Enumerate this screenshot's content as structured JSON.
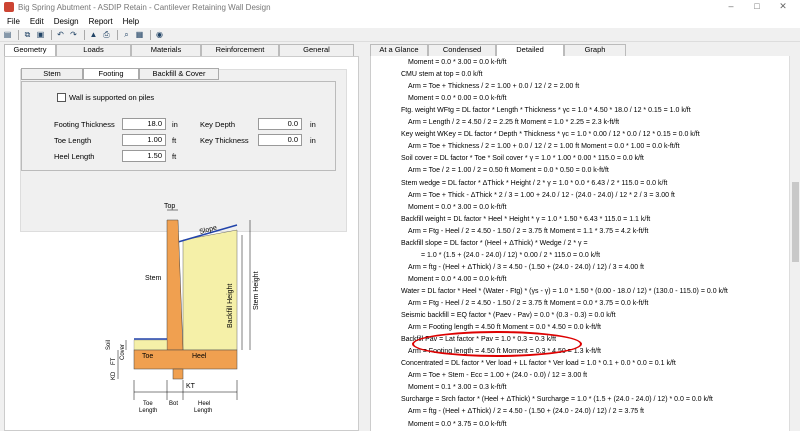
{
  "window": {
    "title": "Big Spring Abutment - ASDIP Retain - Cantilever Retaining Wall Design",
    "controls": [
      "–",
      "□",
      "✕"
    ]
  },
  "menu": [
    "File",
    "Edit",
    "Design",
    "Report",
    "Help"
  ],
  "toolbar": [
    "save-icon",
    "copy-icon",
    "paste-icon",
    "undo-icon",
    "redo-icon",
    "design-icon",
    "print-icon",
    "preview-icon",
    "help-icon"
  ],
  "left_tabs": [
    "Geometry",
    "Loads",
    "Materials",
    "Reinforcement",
    "General"
  ],
  "right_tabs": [
    "At a Glance",
    "Condensed",
    "Detailed",
    "Graph"
  ],
  "sub_tabs": [
    "Stem",
    "Footing",
    "Backfill & Cover"
  ],
  "footing": {
    "piles_label": "Wall is supported on piles",
    "thickness_label": "Footing Thickness",
    "thickness": "18.0",
    "thickness_unit": "in",
    "toe_label": "Toe Length",
    "toe": "1.00",
    "toe_unit": "ft",
    "heel_label": "Heel Length",
    "heel": "1.50",
    "heel_unit": "ft",
    "key_depth_label": "Key Depth",
    "key_depth": "0.0",
    "key_depth_unit": "in",
    "key_thick_label": "Key Thickness",
    "key_thick": "0.0",
    "key_thick_unit": "in"
  },
  "diagram_labels": {
    "top": "Top",
    "slope": "Slope",
    "stem": "Stem",
    "stem_height": "Stem Height",
    "backfill_height": "Backfill Height",
    "cover": "Cover",
    "soil": "Soil",
    "toe": "Toe",
    "heel": "Heel",
    "ft": "FT",
    "kd": "KD",
    "kt": "KT",
    "bot": "Bot",
    "toe_length": "Toe Length",
    "heel_length": "Heel Length",
    "toe_length_a": "Toe",
    "toe_length_b": "Length",
    "heel_length_a": "Heel",
    "heel_length_b": "Length"
  },
  "report_lines": [
    {
      "t": "Moment = 0.0 * 3.00 = 0.0 k-ft/ft",
      "c": "ind"
    },
    {
      "t": "CMU stem at top =  0.0 k/ft",
      "c": ""
    },
    {
      "t": "Arm = Toe + Thickness / 2 =   1.00 + 0.0 / 12 / 2 = 2.00 ft",
      "c": "ind"
    },
    {
      "t": "Moment = 0.0 * 0.00 =  0.0 k-ft/ft",
      "c": "ind"
    },
    {
      "t": "Ftg. weight  WFtg = DL factor * Length * Thickness * γc = 1.0 * 4.50 * 18.0 / 12 * 0.15 = 1.0 k/ft",
      "c": ""
    },
    {
      "t": "Arm = Length / 2 =  4.50 / 2 = 2.25 ft                         Moment =  1.0 * 2.25 = 2.3 k-ft/ft",
      "c": "ind"
    },
    {
      "t": "Key weight  WKey = DL factor * Depth * Thickness * γc = 1.0 * 0.00 / 12 * 0.0 / 12 * 0.15 = 0.0 k/ft",
      "c": ""
    },
    {
      "t": "Arm = Toe + Thickness / 2 = 1.00 + 0.0 / 12 / 2 = 1.00 ft               Moment = 0.0 * 1.00 = 0.0 k-ft/ft",
      "c": "ind"
    },
    {
      "t": "Soil cover =  DL factor * Toe * Soil cover * γ = 1.0 * 1.00 * 0.00 * 115.0 = 0.0 k/ft",
      "c": ""
    },
    {
      "t": "Arm = Toe / 2 =   1.00 / 2 = 0.50 ft                            Moment =  0.0 * 0.50 = 0.0 k-ft/ft",
      "c": "ind"
    },
    {
      "t": "Stem wedge =  DL factor * ΔThick * Height / 2 * γ = 1.0 * 0.0 * 6.43 / 2 * 115.0 = 0.0 k/ft",
      "c": ""
    },
    {
      "t": "Arm = Toe + Thick - ΔThick * 2 / 3 =  1.00 + 24.0 / 12 - (24.0 - 24.0) / 12 * 2 / 3 = 3.00 ft",
      "c": "ind"
    },
    {
      "t": "Moment = 0.0 * 3.00 = 0.0 k-ft/ft",
      "c": "ind"
    },
    {
      "t": "Backfill weight = DL factor * Heel * Height * γ =  1.0 * 1.50 * 6.43 * 115.0 = 1.1 k/ft",
      "c": ""
    },
    {
      "t": "Arm = Ftg - Heel / 2 = 4.50 - 1.50 / 2 = 3.75 ft                 Moment =  1.1 * 3.75 = 4.2 k-ft/ft",
      "c": "ind"
    },
    {
      "t": "Backfill slope =  DL factor * (Heel + ΔThick) * Wedge / 2 * γ =",
      "c": ""
    },
    {
      "t": "= 1.0 * (1.5 + (24.0 - 24.0) / 12) * 0.00 / 2 * 115.0 = 0.0 k/ft",
      "c": "ind2"
    },
    {
      "t": "Arm = ftg - (Heel + ΔThick) / 3 =  4.50 - (1.50 + (24.0 - 24.0) / 12) / 3 = 4.00 ft",
      "c": "ind"
    },
    {
      "t": "Moment = 0.0 * 4.00 =  0.0 k-ft/ft",
      "c": "ind"
    },
    {
      "t": "Water =  DL factor * Heel * (Water - Ftg) * (γs - γ) = 1.0 * 1.50 * (0.00 - 18.0 / 12) * (130.0 - 115.0) = 0.0 k/ft",
      "c": ""
    },
    {
      "t": "Arm = Ftg - Heel / 2 =  4.50 - 1.50 / 2 = 3.75 ft                     Moment =  0.0 * 3.75 = 0.0 k-ft/ft",
      "c": "ind"
    },
    {
      "t": "Seismic backfill =   EQ factor * (Paev - Pav) =   0.0 * (0.3 - 0.3) = 0.0 k/ft",
      "c": ""
    },
    {
      "t": "Arm = Footing length = 4.50 ft                                        Moment =  0.0 * 4.50 = 0.0 k-ft/ft",
      "c": "ind"
    },
    {
      "t": "Backfill Pav =   Lat factor * Pav =  1.0 * 0.3 =  0.3 k/ft",
      "c": ""
    },
    {
      "t": "Arm = Footing length = 4.50 ft                                        Moment =  0.3 * 4.50 = 1.3 k-ft/ft",
      "c": "ind"
    },
    {
      "t": "Concentrated =   DL factor * Ver load + LL factor * Ver load = 1.0 * 0.1 + 0.0 * 0.0 = 0.1 k/ft",
      "c": ""
    },
    {
      "t": "Arm = Toe + Stem - Ecc =  1.00 + (24.0 - 0.0) / 12 = 3.00 ft",
      "c": "ind"
    },
    {
      "t": "Moment = 0.1 * 3.00 = 0.3 k-ft/ft",
      "c": "ind"
    },
    {
      "t": "Surcharge = Srch factor * (Heel + ΔThick) * Surcharge = 1.0 * (1.5 + (24.0 - 24.0) / 12) * 0.0 = 0.0 k/ft",
      "c": ""
    },
    {
      "t": "Arm = ftg - (Heel + ΔThick) / 2 =  4.50 - (1.50 + (24.0 - 24.0) / 12) / 2 = 3.75 ft",
      "c": "ind"
    },
    {
      "t": "Moment = 0.0 * 3.75 = 0.0 k-ft/ft",
      "c": "ind"
    }
  ]
}
